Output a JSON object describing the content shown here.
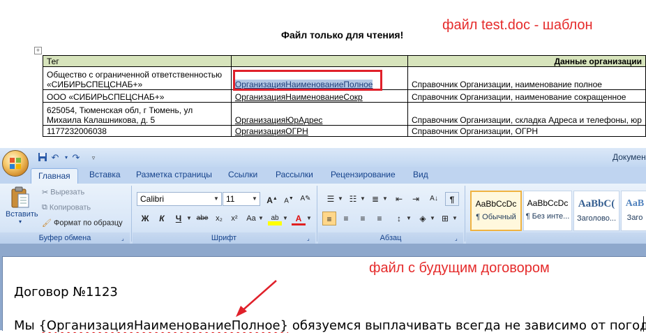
{
  "top_doc": {
    "readonly_title": "Файл только для чтения!",
    "annotation": "файл test.doc - шаблон",
    "table": {
      "headers": [
        "Тег",
        "",
        "Данные организации"
      ],
      "rows": [
        {
          "org": "Общество с ограниченной ответственностью «СИБИРЬСПЕЦСНАБ+»",
          "org_line1": "Общество с ограниченной ответственностью",
          "org_line2": "«СИБИРЬСПЕЦСНАБ+»",
          "tag": "ОрганизацияНаименованиеПолное",
          "desc": "Справочник Организации, наименование полное"
        },
        {
          "org": "ООО «СИБИРЬСПЕЦСНАБ+»",
          "tag": "ОрганизацияНаименованиеСокр",
          "desc": "Справочник Организации, наименование сокращенное"
        },
        {
          "org_line1": "625054, Тюменская обл, г Тюмень, ул",
          "org_line2": "Михаила Калашникова, д. 5",
          "tag": "ОрганизацияЮрАдрес",
          "desc": "Справочник Организации, складка Адреса и телефоны, юр"
        },
        {
          "org": "1177232006038",
          "tag": "ОрганизацияОГРН",
          "desc": "Справочник Организации, ОГРН"
        }
      ]
    }
  },
  "word": {
    "window_title": "Докумен",
    "tabs": [
      "Главная",
      "Вставка",
      "Разметка страницы",
      "Ссылки",
      "Рассылки",
      "Рецензирование",
      "Вид"
    ],
    "active_tab": "Главная",
    "clipboard": {
      "paste_label": "Вставить",
      "cut_label": "Вырезать",
      "copy_label": "Копировать",
      "format_painter_label": "Формат по образцу",
      "group_label": "Буфер обмена"
    },
    "font": {
      "font_name": "Calibri",
      "font_size": "11",
      "group_label": "Шрифт",
      "bold": "Ж",
      "italic": "К",
      "underline": "Ч",
      "strike": "abe",
      "subscript": "x₂",
      "superscript": "x²",
      "change_case": "Aa",
      "grow": "A",
      "shrink": "A",
      "highlight": "ab",
      "font_color": "A"
    },
    "paragraph": {
      "group_label": "Абзац"
    },
    "styles": [
      {
        "sample": "AaBbCcDc",
        "name": "¶ Обычный"
      },
      {
        "sample": "AaBbCcDc",
        "name": "¶ Без инте..."
      },
      {
        "sample": "AaBbC(",
        "name": "Заголово..."
      },
      {
        "sample": "AaB",
        "name": "Заго"
      }
    ],
    "document": {
      "annotation": "файл с будущим договором",
      "heading": "Договор №1123",
      "line_prefix": "Мы ",
      "line_field": "{ОрганизацияНаименованиеПолное}",
      "line_suffix": " обязуемся выплачивать всегда не зависимо от погоды"
    }
  },
  "colors": {
    "annotation_red": "#e52b2b",
    "table_header_green": "#d7e4bc",
    "ribbon_blue": "#dbe8f8",
    "selected_style_border": "#f0b341"
  }
}
